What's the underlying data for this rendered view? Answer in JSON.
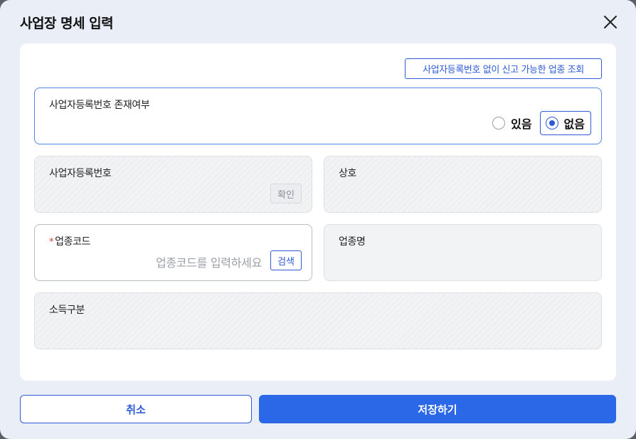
{
  "modal": {
    "title": "사업장 명세 입력"
  },
  "lookup_button": "사업자등록번호 없이 신고 가능한 업종 조회",
  "fields": {
    "brn_exists": {
      "label": "사업자등록번호 존재여부",
      "options": [
        {
          "label": "있음",
          "selected": false
        },
        {
          "label": "없음",
          "selected": true
        }
      ]
    },
    "brn": {
      "label": "사업자등록번호",
      "confirm_label": "확인"
    },
    "trade_name": {
      "label": "상호"
    },
    "industry_code": {
      "required_mark": "*",
      "label": "업종코드",
      "placeholder": "업종코드를 입력하세요",
      "search_label": "검색"
    },
    "industry_name": {
      "label": "업종명"
    },
    "income_type": {
      "label": "소득구분"
    }
  },
  "footer": {
    "cancel_label": "취소",
    "save_label": "저장하기"
  },
  "colors": {
    "accent": "#2f5bd6",
    "primary_button": "#2a68e8",
    "modal_bg": "#e9eef7",
    "required": "#e03a3a"
  }
}
